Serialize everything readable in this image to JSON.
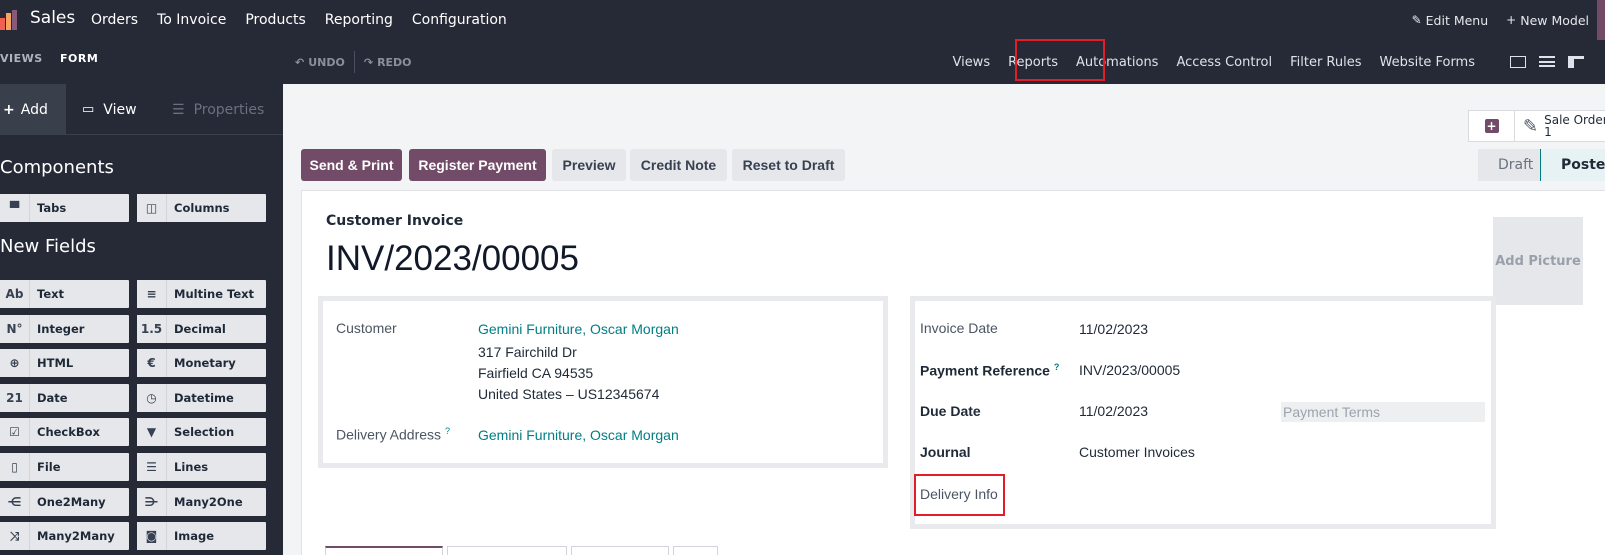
{
  "topbar": {
    "app_name": "Sales",
    "menu": [
      "Orders",
      "To Invoice",
      "Products",
      "Reporting",
      "Configuration"
    ],
    "edit_menu": "Edit Menu",
    "new_model": "New Model"
  },
  "studio": {
    "views_label": "VIEWS",
    "form_label": "FORM",
    "undo": "UNDO",
    "redo": "REDO",
    "menu": [
      "Views",
      "Reports",
      "Automations",
      "Access Control",
      "Filter Rules",
      "Website Forms"
    ]
  },
  "sidebar": {
    "tabs": [
      "Add",
      "View",
      "Properties"
    ],
    "components_title": "Components",
    "components": [
      {
        "label": "Tabs",
        "icon": "tabs-icon"
      },
      {
        "label": "Columns",
        "icon": "columns-icon"
      }
    ],
    "new_fields_title": "New Fields",
    "fields": [
      {
        "label": "Text",
        "glyph": "Ab"
      },
      {
        "label": "Multine Text",
        "glyph": "≡"
      },
      {
        "label": "Integer",
        "glyph": "N°"
      },
      {
        "label": "Decimal",
        "glyph": "1.5"
      },
      {
        "label": "HTML",
        "glyph": "⊕"
      },
      {
        "label": "Monetary",
        "glyph": "€"
      },
      {
        "label": "Date",
        "glyph": "21"
      },
      {
        "label": "Datetime",
        "glyph": "◷"
      },
      {
        "label": "CheckBox",
        "glyph": "☑"
      },
      {
        "label": "Selection",
        "glyph": "▼"
      },
      {
        "label": "File",
        "glyph": "▯"
      },
      {
        "label": "Lines",
        "glyph": "☰"
      },
      {
        "label": "One2Many",
        "glyph": "⋲"
      },
      {
        "label": "Many2One",
        "glyph": "⋺"
      },
      {
        "label": "Many2Many",
        "glyph": "⤨"
      },
      {
        "label": "Image",
        "glyph": "◙"
      }
    ]
  },
  "actions": {
    "send_print": "Send & Print",
    "register_payment": "Register Payment",
    "preview": "Preview",
    "credit_note": "Credit Note",
    "reset_draft": "Reset to Draft"
  },
  "smart": {
    "sale_order_label": "Sale Order",
    "sale_order_count": "1"
  },
  "statusbar": {
    "draft": "Draft",
    "posted": "Posted"
  },
  "invoice": {
    "type_label": "Customer Invoice",
    "number": "INV/2023/00005",
    "add_picture": "Add Picture",
    "customer_label": "Customer",
    "customer_name": "Gemini Furniture, Oscar Morgan",
    "address_line1": "317 Fairchild Dr",
    "address_line2": "Fairfield CA 94535",
    "address_line3": "United States – US12345674",
    "delivery_address_label": "Delivery Address",
    "delivery_address_value": "Gemini Furniture, Oscar Morgan",
    "invoice_date_label": "Invoice Date",
    "invoice_date": "11/02/2023",
    "payment_ref_label": "Payment Reference",
    "payment_ref": "INV/2023/00005",
    "due_date_label": "Due Date",
    "due_date": "11/02/2023",
    "payment_terms_placeholder": "Payment Terms",
    "journal_label": "Journal",
    "journal": "Customer Invoices",
    "delivery_info_label": "Delivery Info",
    "help_mark": "?"
  },
  "colors": {
    "brand": "#714b67",
    "link": "#017e84",
    "highlight": "#e11d2a",
    "dark_bg": "#262a36"
  }
}
